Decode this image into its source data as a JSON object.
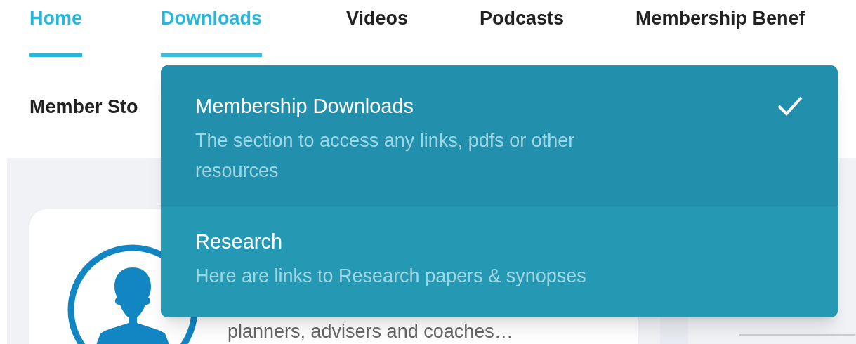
{
  "nav": {
    "tabs": [
      {
        "label": "Home",
        "selected": true,
        "expanded": false
      },
      {
        "label": "Downloads",
        "selected": false,
        "expanded": true
      },
      {
        "label": "Videos",
        "selected": false,
        "expanded": false
      },
      {
        "label": "Podcasts",
        "selected": false,
        "expanded": false
      },
      {
        "label": "Membership Benef",
        "selected": false,
        "expanded": false
      }
    ]
  },
  "subnav": {
    "label": "Member Sto"
  },
  "dropdown": {
    "items": [
      {
        "title": "Membership Downloads",
        "description": "The section to access any links, pdfs or other resources",
        "selected": true
      },
      {
        "title": "Research",
        "description": "Here are links to Research papers & synopses",
        "selected": false
      }
    ]
  },
  "card": {
    "text": "planners, advisers and coaches…"
  }
}
